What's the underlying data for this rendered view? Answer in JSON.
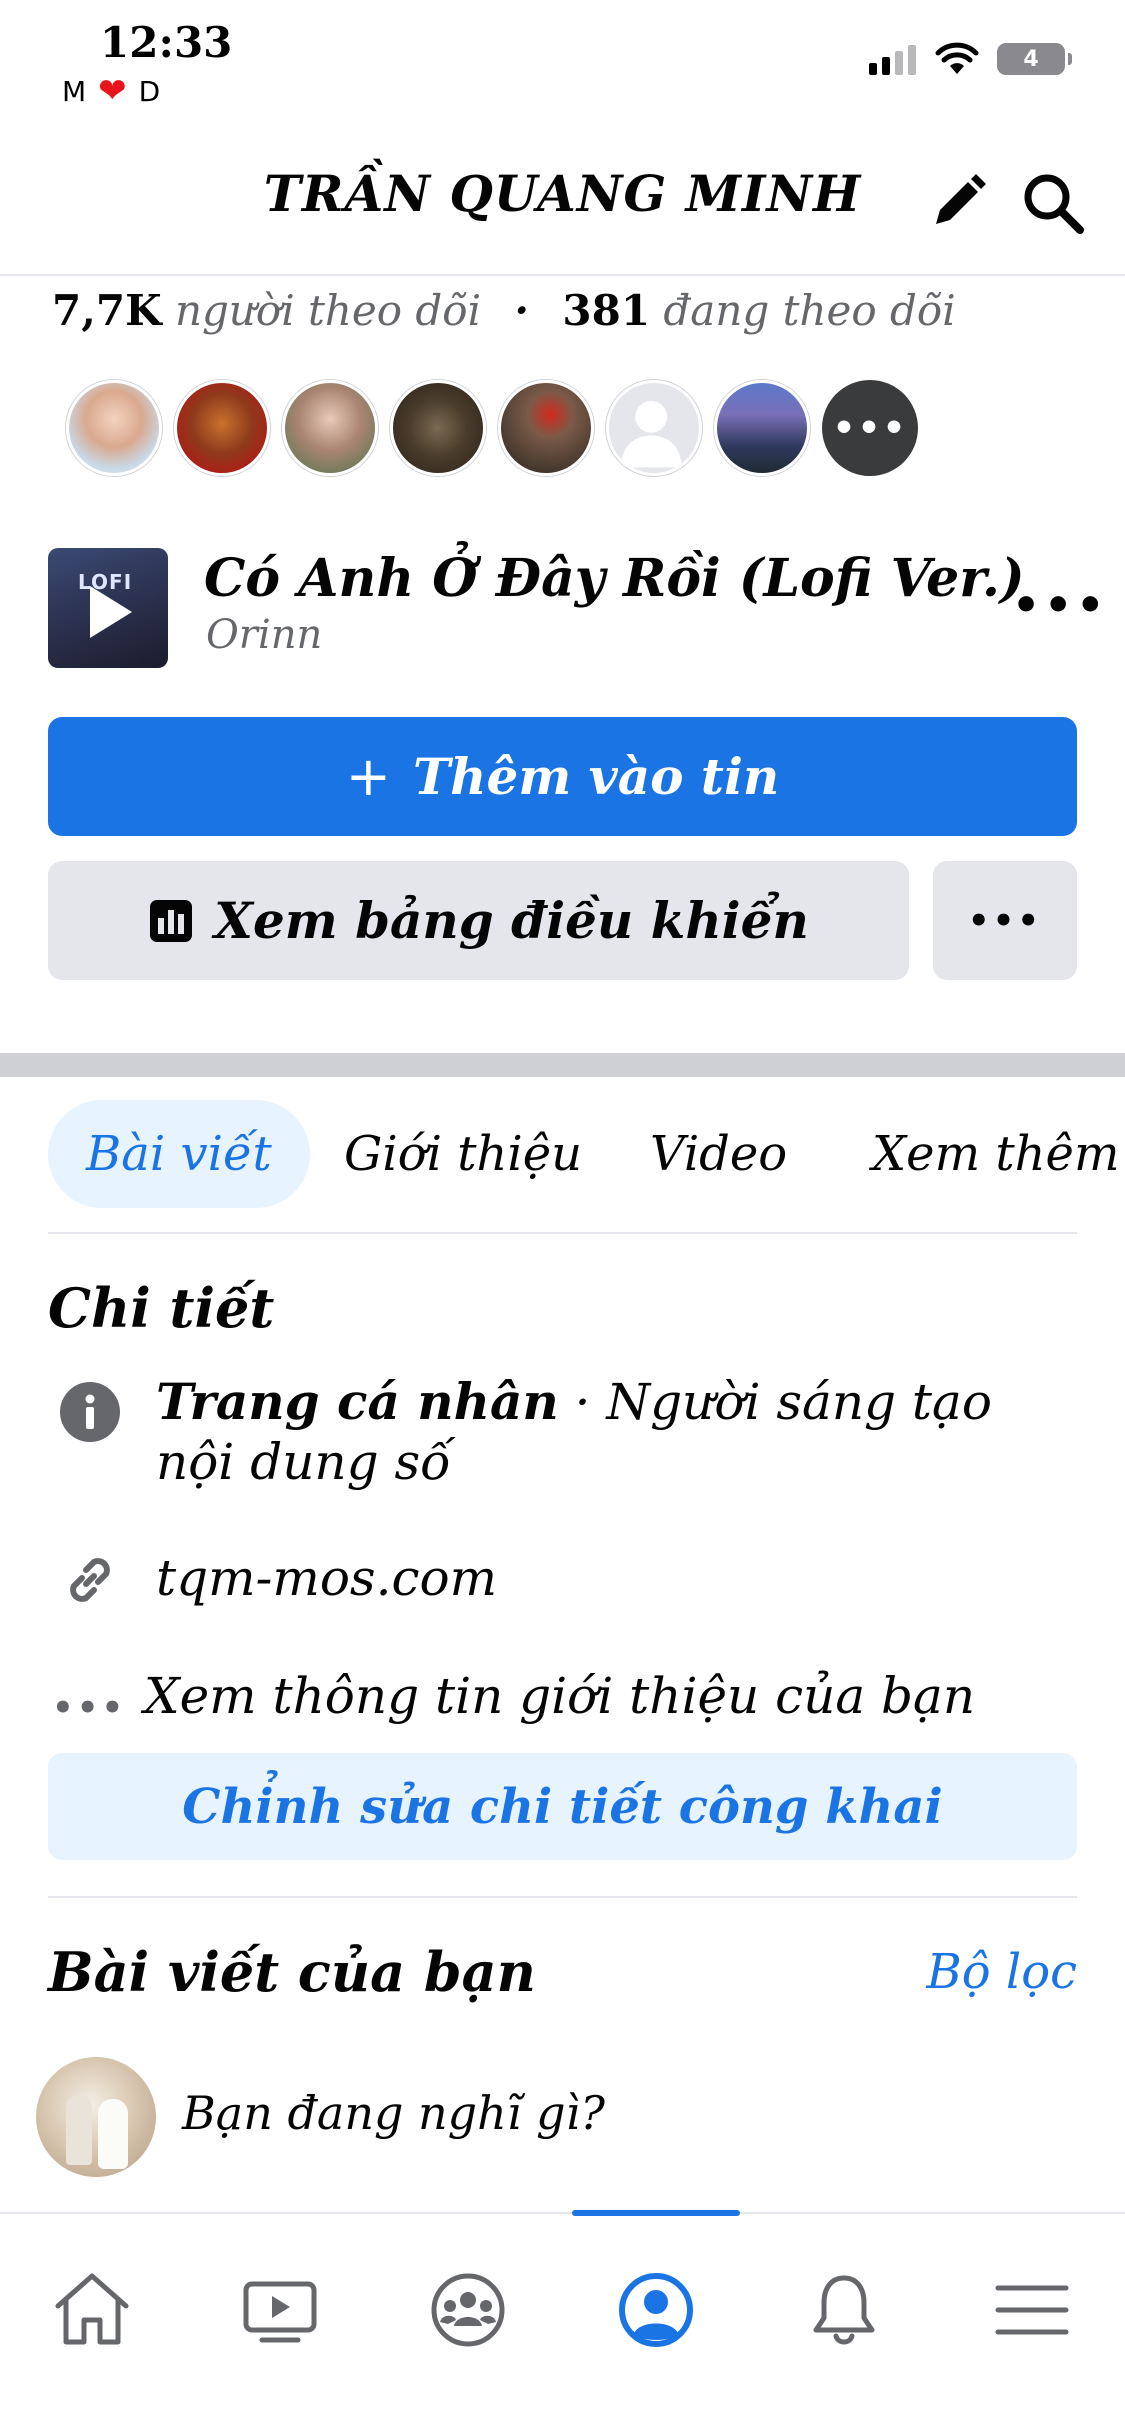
{
  "status_bar": {
    "time": "12:33",
    "carrier_left": "M",
    "carrier_right": "D",
    "battery": "4"
  },
  "header": {
    "title": "TRẦN QUANG MINH",
    "edit_icon": "pencil-icon",
    "search_icon": "search-icon"
  },
  "stats": {
    "followers_count": "7,7K",
    "followers_label": "người theo dõi",
    "following_count": "381",
    "following_label": "đang theo dõi"
  },
  "music": {
    "cover_text": "LOFI",
    "title": "Có Anh Ở Đây Rồi (Lofi Ver.)",
    "artist": "Orinn"
  },
  "actions": {
    "add_story": "Thêm vào tin",
    "dashboard": "Xem bảng điều khiển"
  },
  "tabs": [
    {
      "label": "Bài viết",
      "active": true
    },
    {
      "label": "Giới thiệu",
      "active": false
    },
    {
      "label": "Video",
      "active": false
    },
    {
      "label": "Xem thêm",
      "active": false
    }
  ],
  "details": {
    "title": "Chi tiết",
    "page_type_bold": "Trang cá nhân",
    "page_type_rest": " · Người sáng tạo nội dung số",
    "website": "tqm-mos.com",
    "see_about": "Xem thông tin giới thiệu của bạn",
    "edit_button": "Chỉnh sửa chi tiết công khai"
  },
  "posts": {
    "title": "Bài viết của bạn",
    "filter": "Bộ lọc",
    "composer_placeholder": "Bạn đang nghĩ gì?"
  },
  "bottom_nav": [
    {
      "icon": "home-icon"
    },
    {
      "icon": "video-icon"
    },
    {
      "icon": "groups-icon"
    },
    {
      "icon": "profile-icon",
      "active": true
    },
    {
      "icon": "bell-icon"
    },
    {
      "icon": "menu-icon"
    }
  ],
  "colors": {
    "accent": "#1b74e4",
    "light_accent": "#e7f3ff",
    "button_gray": "#e4e6eb",
    "secondary_text": "#65676b"
  }
}
